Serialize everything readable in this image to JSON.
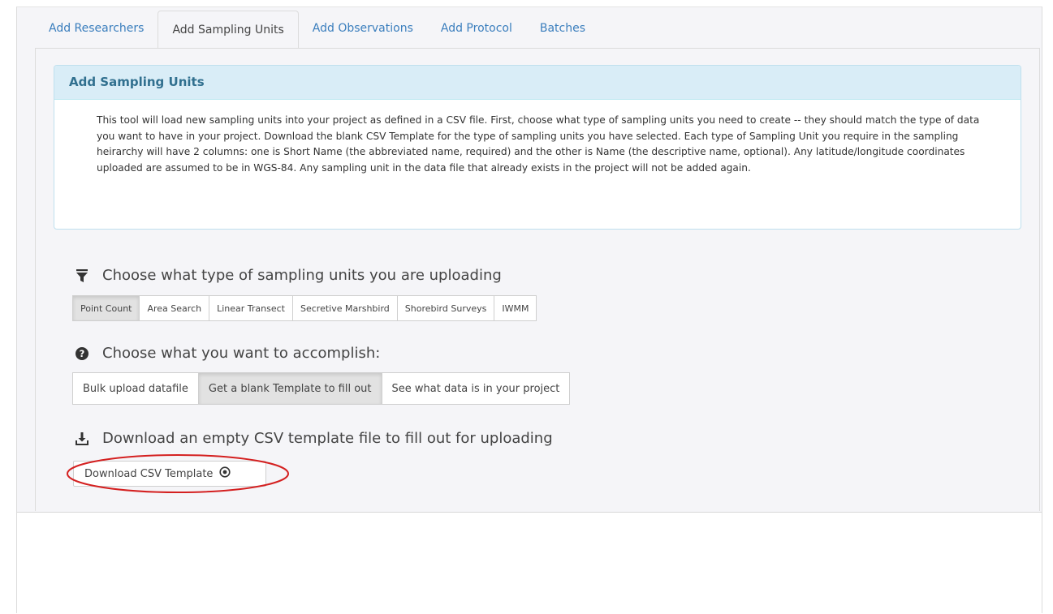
{
  "tabs": [
    {
      "label": "Add Researchers"
    },
    {
      "label": "Add Sampling Units"
    },
    {
      "label": "Add Observations"
    },
    {
      "label": "Add Protocol"
    },
    {
      "label": "Batches"
    }
  ],
  "panel": {
    "title": "Add Sampling Units",
    "description": "This tool will load new sampling units into your project as defined in a CSV file. First, choose what type of sampling units you need to create -- they should match the type of data you want to have in your project. Download the blank CSV Template for the type of sampling units you have selected. Each type of Sampling Unit you require in the sampling heirarchy will have 2 columns: one is Short Name (the abbreviated name, required) and the other is Name (the descriptive name, optional). Any latitude/longitude coordinates uploaded are assumed to be in WGS-84. Any sampling unit in the data file that already exists in the project will not be added again."
  },
  "unit_type": {
    "heading": "Choose what type of sampling units you are uploading",
    "icon": "filter-icon",
    "options": [
      "Point Count",
      "Area Search",
      "Linear Transect",
      "Secretive Marshbird",
      "Shorebird Surveys",
      "IWMM"
    ],
    "selected": "Point Count"
  },
  "accomplish": {
    "heading": "Choose what you want to accomplish:",
    "icon": "question-circle-icon",
    "options": [
      "Bulk upload datafile",
      "Get a blank Template to fill out",
      "See what data is in your project"
    ],
    "selected": "Get a blank Template to fill out"
  },
  "download": {
    "heading": "Download an empty CSV template file to fill out for uploading",
    "icon": "download-icon",
    "button_label": "Download CSV Template",
    "button_icon": "dot-circle-icon"
  },
  "colors": {
    "link": "#3a7ebd",
    "panel_heading_bg": "#d9edf7",
    "annotation": "#d42020"
  }
}
